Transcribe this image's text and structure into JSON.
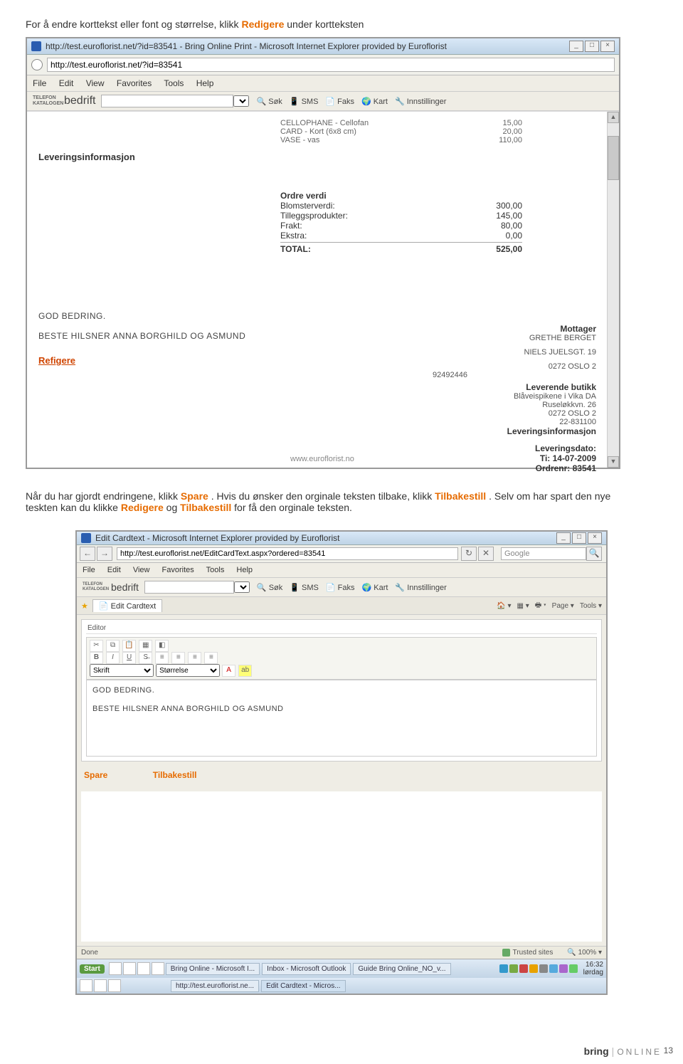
{
  "intro": {
    "p1a": "For å endre korttekst eller font og størrelse, klikk ",
    "redigere": "Redigere",
    "p1b": " under kortteksten"
  },
  "win1": {
    "title": "http://test.euroflorist.net/?id=83541 - Bring Online Print - Microsoft Internet Explorer provided by Euroflorist",
    "url": "http://test.euroflorist.net/?id=83541",
    "menus": [
      "File",
      "Edit",
      "View",
      "Favorites",
      "Tools",
      "Help"
    ],
    "brand_small": "TELEFON KATALOGEN",
    "brand": "bedrift",
    "tb_search": "Søk",
    "tb_sms": "SMS",
    "tb_faks": "Faks",
    "tb_kart": "Kart",
    "tb_innst": "Innstillinger",
    "products": [
      {
        "name": "CELLOPHANE - Cellofan",
        "price": "15,00"
      },
      {
        "name": "CARD - Kort (6x8 cm)",
        "price": "20,00"
      },
      {
        "name": "VASE - vas",
        "price": "110,00"
      }
    ],
    "levinfo": "Leveringsinformasjon",
    "order_head": "Ordre verdi",
    "order": {
      "blomster_l": "Blomsterverdi:",
      "blomster_v": "300,00",
      "tillegg_l": "Tilleggsprodukter:",
      "tillegg_v": "145,00",
      "frakt_l": "Frakt:",
      "frakt_v": "80,00",
      "ekstra_l": "Ekstra:",
      "ekstra_v": "0,00",
      "total_l": "TOTAL:",
      "total_v": "525,00"
    },
    "msg1": "GOD BEDRING.",
    "msg2": "BESTE HILSNER ANNA BORGHILD OG ASMUND",
    "redigere": "Refigere",
    "recipient": {
      "head": "Mottager",
      "name": "GRETHE BERGET",
      "street": "NIELS JUELSGT. 19",
      "city": "0272 OSLO 2",
      "phone": "92492446"
    },
    "shop": {
      "head": "Leverende butikk",
      "name": "Blåveispikene i Vika DA",
      "street": "Ruseløkkvn. 26",
      "city": "0272 OSLO 2",
      "phone": "22-831100"
    },
    "levinfo2": "Leveringsinformasjon",
    "levdato_l": "Leveringsdato:",
    "levdato_v": "Ti: 14-07-2009",
    "ordrenr_l": "Ordrenr: 83541",
    "footer_url": "www.euroflorist.no"
  },
  "para2": {
    "p1": "Når du har gjordt endringene, klikk ",
    "spare": "Spare",
    "p2": ". Hvis du ønsker den orginale teksten tilbake, klikk ",
    "tilbakestill": "Tilbakestill",
    "p3": ". Selv om har spart den nye teskten kan du klikke ",
    "redigere": "Redigere",
    "p4": "  og ",
    "tilbakestill2": "Tilbakestill",
    "p5": " for få den orginale teksten."
  },
  "win2": {
    "title": "Edit Cardtext - Microsoft Internet Explorer provided by Euroflorist",
    "url": "http://test.euroflorist.net/EditCardText.aspx?ordered=83541",
    "google": "Google",
    "menus": [
      "File",
      "Edit",
      "View",
      "Favorites",
      "Tools",
      "Help"
    ],
    "brand_small": "TELEFON KATALOGEN",
    "brand": "bedrift",
    "tb_search": "Søk",
    "tb_sms": "SMS",
    "tb_faks": "Faks",
    "tb_kart": "Kart",
    "tb_innst": "Innstillinger",
    "tab": "Edit Cardtext",
    "page": "Page",
    "tools": "Tools",
    "editor_label": "Editor",
    "font_family": "Skrift",
    "font_size": "Størrelse",
    "body1": "GOD BEDRING.",
    "body2": "BESTE HILSNER ANNA BORGHILD OG ASMUND",
    "spare": "Spare",
    "tilbakestill": "Tilbakestill",
    "status_done": "Done",
    "status_zone": "Trusted sites",
    "status_zoom": "100%",
    "start": "Start",
    "tasks": [
      "Bring Online - Microsoft I...",
      "Inbox - Microsoft Outlook",
      "Guide Bring Online_NO_v...",
      "http://test.euroflorist.ne...",
      "Edit Cardtext - Micros..."
    ],
    "clock_time": "16:32",
    "clock_day": "lørdag"
  },
  "footer": {
    "brand": "bring",
    "online": "ONLINE",
    "page": "13"
  }
}
